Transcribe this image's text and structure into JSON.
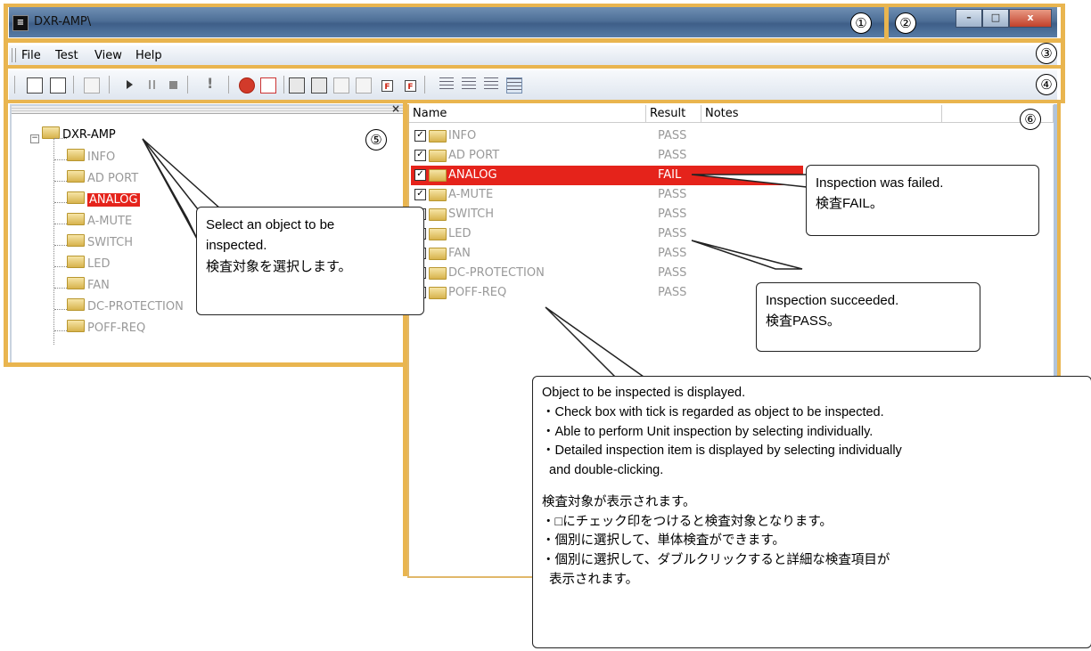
{
  "window": {
    "title": "DXR-AMP\\",
    "icon_text": "≡",
    "buttons": [
      "–",
      "□",
      "x"
    ]
  },
  "menu": [
    "File",
    "Test",
    "View",
    "Help"
  ],
  "toolbar_icons": [
    "save-icon",
    "save-as-icon",
    "print-icon",
    "run-icon",
    "pause-icon",
    "stop-icon",
    "alert-icon",
    "error-icon",
    "clear-icon",
    "check-all-icon",
    "check-selected-icon",
    "check-dim-icon",
    "check-dim-icon",
    "fail-filter-icon",
    "fail-clear-icon",
    "view-large-icon",
    "view-small-icon",
    "view-list-icon",
    "view-details-icon"
  ],
  "numbers": {
    "n1": "①",
    "n2": "②",
    "n3": "③",
    "n4": "④",
    "n5": "⑤",
    "n6": "⑥"
  },
  "tree": {
    "toggle": "−",
    "root": "DXR-AMP",
    "items": [
      {
        "label": "INFO",
        "status": "pass"
      },
      {
        "label": "AD PORT",
        "status": "pass"
      },
      {
        "label": "ANALOG",
        "status": "fail"
      },
      {
        "label": "A-MUTE",
        "status": "pass"
      },
      {
        "label": "SWITCH",
        "status": "pass"
      },
      {
        "label": "LED",
        "status": "pass"
      },
      {
        "label": "FAN",
        "status": "pass"
      },
      {
        "label": "DC-PROTECTION",
        "status": "pass"
      },
      {
        "label": "POFF-REQ",
        "status": "pass"
      }
    ]
  },
  "list": {
    "columns": [
      "Name",
      "Result",
      "Notes"
    ],
    "rows": [
      {
        "name": "INFO",
        "result": "PASS",
        "checked": "✓"
      },
      {
        "name": "AD PORT",
        "result": "PASS",
        "checked": "✓"
      },
      {
        "name": "ANALOG",
        "result": "FAIL",
        "checked": "✓"
      },
      {
        "name": "A-MUTE",
        "result": "PASS",
        "checked": "✓"
      },
      {
        "name": "SWITCH",
        "result": "PASS",
        "checked": "✓"
      },
      {
        "name": "LED",
        "result": "PASS",
        "checked": "✓"
      },
      {
        "name": "FAN",
        "result": "PASS",
        "checked": "✓"
      },
      {
        "name": "DC-PROTECTION",
        "result": "PASS",
        "checked": "✓"
      },
      {
        "name": "POFF-REQ",
        "result": "PASS",
        "checked": "✓"
      }
    ]
  },
  "callouts": {
    "select": {
      "l1": "Select an object to be",
      "l2": "inspected.",
      "l3": "検査対象を選択します。"
    },
    "failed": {
      "l1": "Inspection was failed.",
      "l2": "検査FAIL。"
    },
    "succeeded": {
      "l1": "Inspection succeeded.",
      "l2": "検査PASS。"
    },
    "object": {
      "l1": "Object to be inspected is displayed.",
      "l2": "・Check box with tick is regarded as object to be inspected.",
      "l3": "・Able to perform Unit inspection by selecting individually.",
      "l4": "・Detailed inspection item is displayed by selecting individually",
      "l5": "  and double-clicking.",
      "l6": "検査対象が表示されます。",
      "l7": "・□にチェック印をつけると検査対象となります。",
      "l8": "・個別に選択して、単体検査ができます。",
      "l9": "・個別に選択して、ダブルクリックすると詳細な検査項目が",
      "l10": "  表示されます。"
    }
  },
  "colors": {
    "frame": "#e9b54f",
    "fail": "#e5231b",
    "title_gradient": "#4e6f97"
  }
}
